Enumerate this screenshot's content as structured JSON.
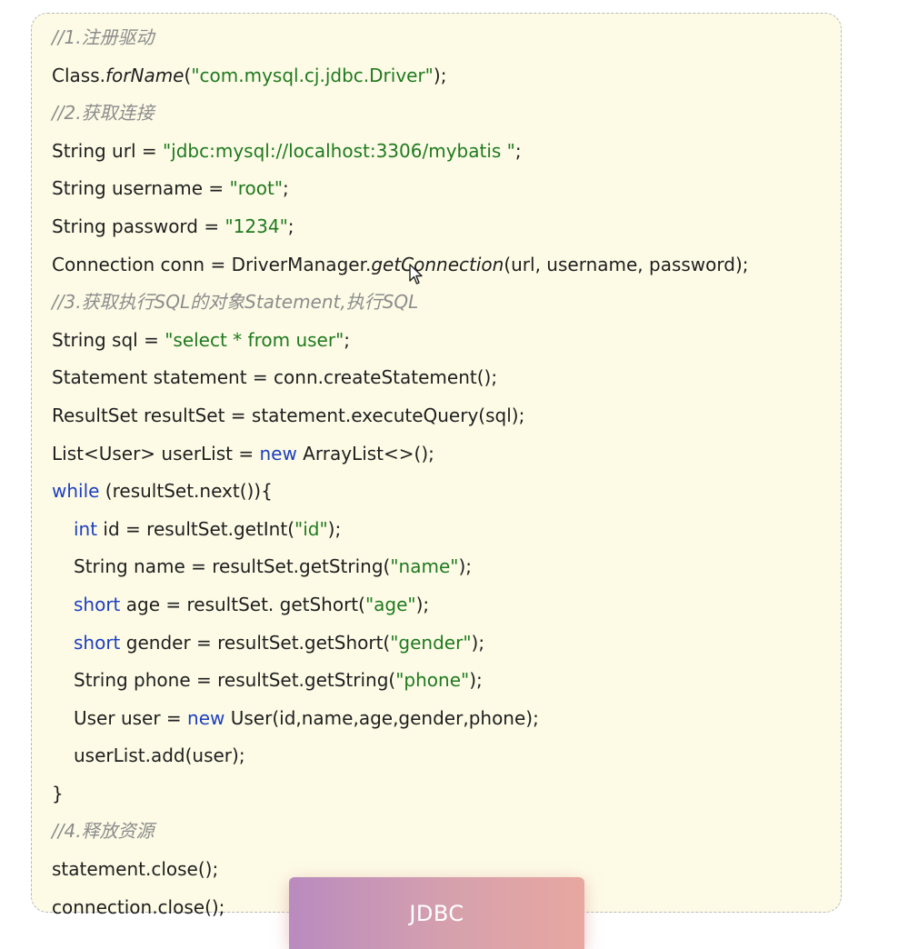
{
  "colors": {
    "card_background": "#fdfbe6",
    "comment": "#8c8c8c",
    "string": "#1f7a1f",
    "keyword": "#1d3fbf",
    "plain": "#1e1e1e",
    "tab_gradient": [
      "#b98bbf",
      "#e8a7a0"
    ]
  },
  "code": {
    "lines": [
      {
        "indent": false,
        "tokens": [
          {
            "kind": "comment",
            "text": "//1.注册驱动"
          }
        ]
      },
      {
        "indent": false,
        "tokens": [
          {
            "kind": "plain",
            "text": "Class."
          },
          {
            "kind": "italic",
            "text": "forName"
          },
          {
            "kind": "plain",
            "text": "("
          },
          {
            "kind": "string",
            "text": "\"com.mysql.cj.jdbc.Driver\""
          },
          {
            "kind": "plain",
            "text": ");"
          }
        ]
      },
      {
        "indent": false,
        "tokens": [
          {
            "kind": "comment",
            "text": "//2.获取连接"
          }
        ]
      },
      {
        "indent": false,
        "tokens": [
          {
            "kind": "plain",
            "text": "String url = "
          },
          {
            "kind": "string",
            "text": "\"jdbc:mysql://localhost:3306/mybatis \""
          },
          {
            "kind": "plain",
            "text": ";"
          }
        ]
      },
      {
        "indent": false,
        "tokens": [
          {
            "kind": "plain",
            "text": "String username = "
          },
          {
            "kind": "string",
            "text": "\"root\""
          },
          {
            "kind": "plain",
            "text": ";"
          }
        ]
      },
      {
        "indent": false,
        "tokens": [
          {
            "kind": "plain",
            "text": "String password = "
          },
          {
            "kind": "string",
            "text": "\"1234\""
          },
          {
            "kind": "plain",
            "text": ";"
          }
        ]
      },
      {
        "indent": false,
        "tokens": [
          {
            "kind": "plain",
            "text": "Connection conn = DriverManager."
          },
          {
            "kind": "italic",
            "text": "getConnection"
          },
          {
            "kind": "plain",
            "text": "(url, username, password);"
          }
        ]
      },
      {
        "indent": false,
        "tokens": [
          {
            "kind": "comment",
            "text": "//3.获取执行SQL的对象Statement,执行SQL"
          }
        ]
      },
      {
        "indent": false,
        "tokens": [
          {
            "kind": "plain",
            "text": "String sql = "
          },
          {
            "kind": "string",
            "text": "\"select * from user\""
          },
          {
            "kind": "plain",
            "text": ";"
          }
        ]
      },
      {
        "indent": false,
        "tokens": [
          {
            "kind": "plain",
            "text": "Statement statement = conn.createStatement();"
          }
        ]
      },
      {
        "indent": false,
        "tokens": [
          {
            "kind": "plain",
            "text": "ResultSet resultSet = statement.executeQuery(sql);"
          }
        ]
      },
      {
        "indent": false,
        "tokens": [
          {
            "kind": "plain",
            "text": "List<User> userList = "
          },
          {
            "kind": "keyword",
            "text": "new"
          },
          {
            "kind": "plain",
            "text": " ArrayList<>();"
          }
        ]
      },
      {
        "indent": false,
        "tokens": [
          {
            "kind": "keyword",
            "text": "while"
          },
          {
            "kind": "plain",
            "text": " (resultSet.next()){"
          }
        ]
      },
      {
        "indent": true,
        "tokens": [
          {
            "kind": "keyword",
            "text": "int"
          },
          {
            "kind": "plain",
            "text": " id = resultSet.getInt("
          },
          {
            "kind": "string",
            "text": "\"id\""
          },
          {
            "kind": "plain",
            "text": ");"
          }
        ]
      },
      {
        "indent": true,
        "tokens": [
          {
            "kind": "plain",
            "text": "String name = resultSet.getString("
          },
          {
            "kind": "string",
            "text": "\"name\""
          },
          {
            "kind": "plain",
            "text": ");"
          }
        ]
      },
      {
        "indent": true,
        "tokens": [
          {
            "kind": "keyword",
            "text": "short"
          },
          {
            "kind": "plain",
            "text": " age = resultSet. getShort("
          },
          {
            "kind": "string",
            "text": "\"age\""
          },
          {
            "kind": "plain",
            "text": ");"
          }
        ]
      },
      {
        "indent": true,
        "tokens": [
          {
            "kind": "keyword",
            "text": "short"
          },
          {
            "kind": "plain",
            "text": " gender = resultSet.getShort("
          },
          {
            "kind": "string",
            "text": "\"gender\""
          },
          {
            "kind": "plain",
            "text": ");"
          }
        ]
      },
      {
        "indent": true,
        "tokens": [
          {
            "kind": "plain",
            "text": "String phone = resultSet.getString("
          },
          {
            "kind": "string",
            "text": "\"phone\""
          },
          {
            "kind": "plain",
            "text": ");"
          }
        ]
      },
      {
        "indent": true,
        "tokens": [
          {
            "kind": "plain",
            "text": "User user = "
          },
          {
            "kind": "keyword",
            "text": "new"
          },
          {
            "kind": "plain",
            "text": " User(id,name,age,gender,phone);"
          }
        ]
      },
      {
        "indent": true,
        "tokens": [
          {
            "kind": "plain",
            "text": "userList.add(user);"
          }
        ]
      },
      {
        "indent": false,
        "tokens": [
          {
            "kind": "plain",
            "text": "}"
          }
        ]
      },
      {
        "indent": false,
        "tokens": [
          {
            "kind": "comment",
            "text": "//4.释放资源"
          }
        ]
      },
      {
        "indent": false,
        "tokens": [
          {
            "kind": "plain",
            "text": "statement.close();"
          }
        ]
      },
      {
        "indent": false,
        "tokens": [
          {
            "kind": "plain",
            "text": "connection.close();"
          }
        ]
      }
    ]
  },
  "tab": {
    "label": "JDBC"
  },
  "icons": {
    "cursor": "mouse-pointer-icon"
  }
}
